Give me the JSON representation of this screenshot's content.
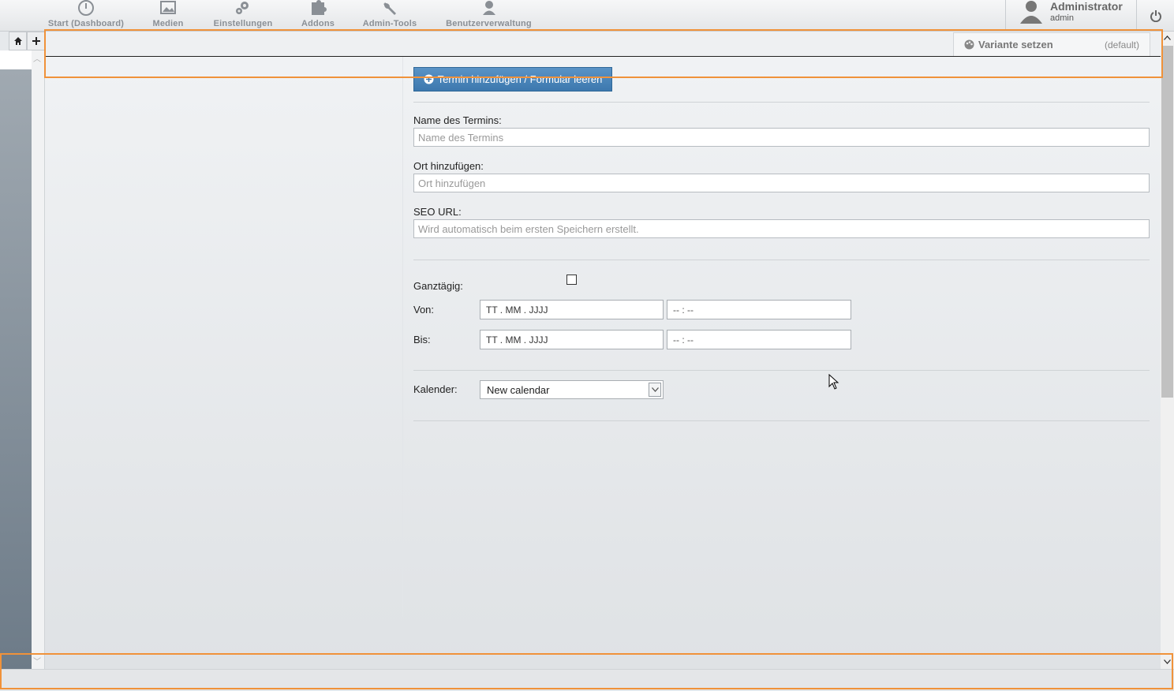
{
  "nav": {
    "items": [
      {
        "label": "Start (Dashboard)",
        "icon": "dashboard-icon"
      },
      {
        "label": "Medien",
        "icon": "media-icon"
      },
      {
        "label": "Einstellungen",
        "icon": "gears-icon"
      },
      {
        "label": "Addons",
        "icon": "puzzle-icon"
      },
      {
        "label": "Admin-Tools",
        "icon": "wrench-icon"
      },
      {
        "label": "Benutzerverwaltung",
        "icon": "users-icon"
      }
    ],
    "user_name": "Administrator",
    "user_role": "admin"
  },
  "toolbar": {
    "variant_label": "Variante setzen",
    "variant_value": "(default)"
  },
  "form": {
    "add_button_label": "Termin hinzufügen / Formular leeren",
    "name_label": "Name des Termins:",
    "name_placeholder": "Name des Termins",
    "place_label": "Ort hinzufügen:",
    "place_placeholder": "Ort hinzufügen",
    "seo_label": "SEO URL:",
    "seo_placeholder": "Wird automatisch beim ersten Speichern erstellt.",
    "allday_label": "Ganztägig:",
    "from_label": "Von:",
    "to_label": "Bis:",
    "date_placeholder": "TT . MM . JJJJ",
    "time_placeholder": "-- : --",
    "calendar_label": "Kalender:",
    "calendar_value": "New calendar"
  }
}
